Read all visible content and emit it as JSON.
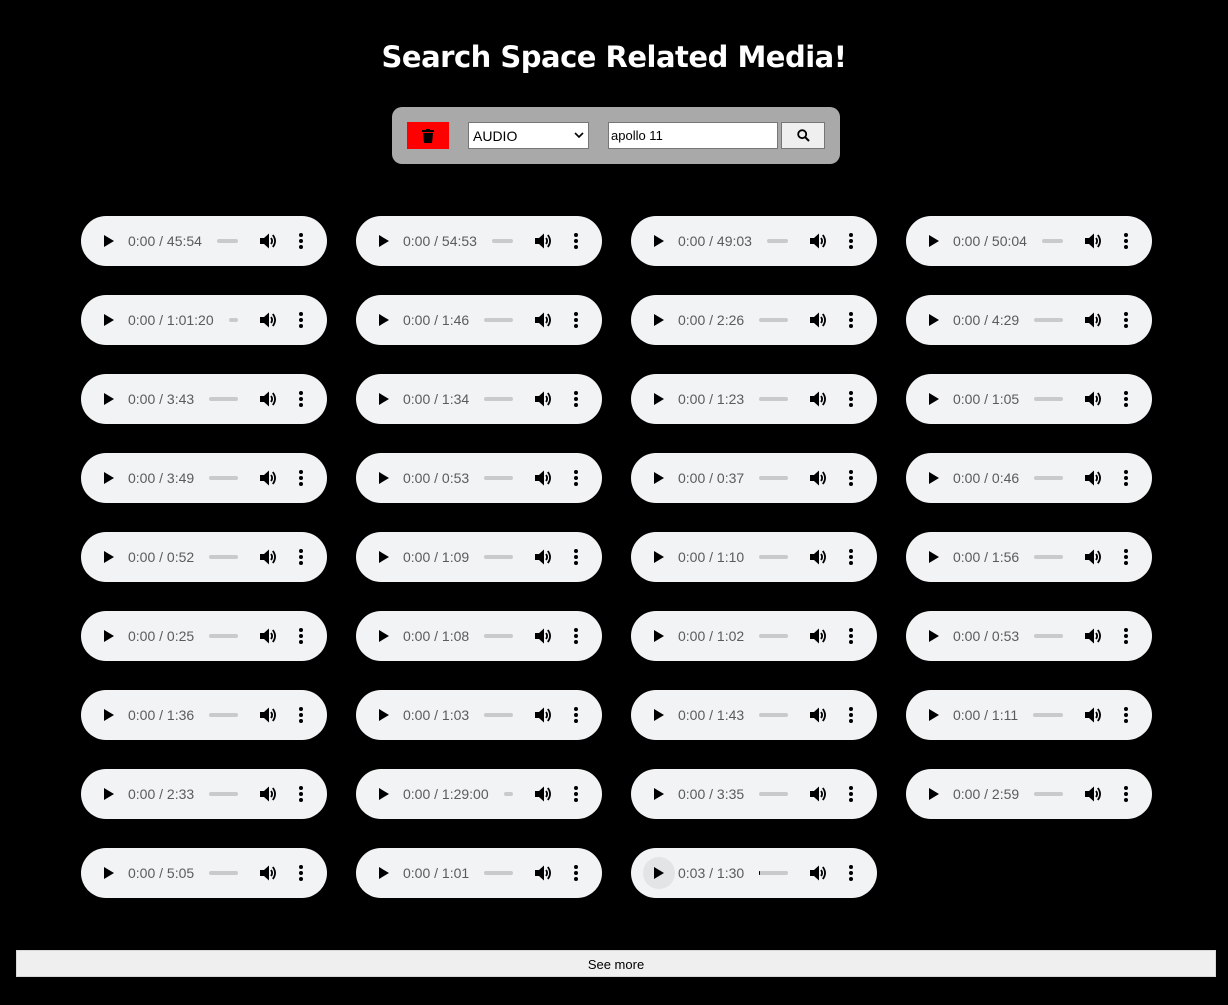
{
  "page": {
    "title": "Search Space Related Media!"
  },
  "search": {
    "clear_icon": "trash-icon",
    "clear_color": "#ff0000",
    "media_type": "AUDIO",
    "query": "apollo 11",
    "search_icon": "magnifier-icon"
  },
  "players": [
    {
      "current": "0:00",
      "duration": "45:54",
      "progress": 0
    },
    {
      "current": "0:00",
      "duration": "54:53",
      "progress": 0
    },
    {
      "current": "0:00",
      "duration": "49:03",
      "progress": 0
    },
    {
      "current": "0:00",
      "duration": "50:04",
      "progress": 0
    },
    {
      "current": "0:00",
      "duration": "1:01:20",
      "progress": 0
    },
    {
      "current": "0:00",
      "duration": "1:46",
      "progress": 0
    },
    {
      "current": "0:00",
      "duration": "2:26",
      "progress": 0
    },
    {
      "current": "0:00",
      "duration": "4:29",
      "progress": 0
    },
    {
      "current": "0:00",
      "duration": "3:43",
      "progress": 0
    },
    {
      "current": "0:00",
      "duration": "1:34",
      "progress": 0
    },
    {
      "current": "0:00",
      "duration": "1:23",
      "progress": 0
    },
    {
      "current": "0:00",
      "duration": "1:05",
      "progress": 0
    },
    {
      "current": "0:00",
      "duration": "3:49",
      "progress": 0
    },
    {
      "current": "0:00",
      "duration": "0:53",
      "progress": 0
    },
    {
      "current": "0:00",
      "duration": "0:37",
      "progress": 0
    },
    {
      "current": "0:00",
      "duration": "0:46",
      "progress": 0
    },
    {
      "current": "0:00",
      "duration": "0:52",
      "progress": 0
    },
    {
      "current": "0:00",
      "duration": "1:09",
      "progress": 0
    },
    {
      "current": "0:00",
      "duration": "1:10",
      "progress": 0
    },
    {
      "current": "0:00",
      "duration": "1:56",
      "progress": 0
    },
    {
      "current": "0:00",
      "duration": "0:25",
      "progress": 0
    },
    {
      "current": "0:00",
      "duration": "1:08",
      "progress": 0
    },
    {
      "current": "0:00",
      "duration": "1:02",
      "progress": 0
    },
    {
      "current": "0:00",
      "duration": "0:53",
      "progress": 0
    },
    {
      "current": "0:00",
      "duration": "1:36",
      "progress": 0
    },
    {
      "current": "0:00",
      "duration": "1:03",
      "progress": 0
    },
    {
      "current": "0:00",
      "duration": "1:43",
      "progress": 0
    },
    {
      "current": "0:00",
      "duration": "1:11",
      "progress": 0
    },
    {
      "current": "0:00",
      "duration": "2:33",
      "progress": 0
    },
    {
      "current": "0:00",
      "duration": "1:29:00",
      "progress": 0
    },
    {
      "current": "0:00",
      "duration": "3:35",
      "progress": 0
    },
    {
      "current": "0:00",
      "duration": "2:59",
      "progress": 0
    },
    {
      "current": "0:00",
      "duration": "5:05",
      "progress": 0
    },
    {
      "current": "0:00",
      "duration": "1:01",
      "progress": 0
    },
    {
      "current": "0:03",
      "duration": "1:30",
      "progress": 0.033,
      "focused": true
    }
  ],
  "player_icons": {
    "play": "play-icon",
    "volume": "volume-icon",
    "more": "more-options-icon"
  },
  "footer": {
    "see_more_label": "See more"
  }
}
